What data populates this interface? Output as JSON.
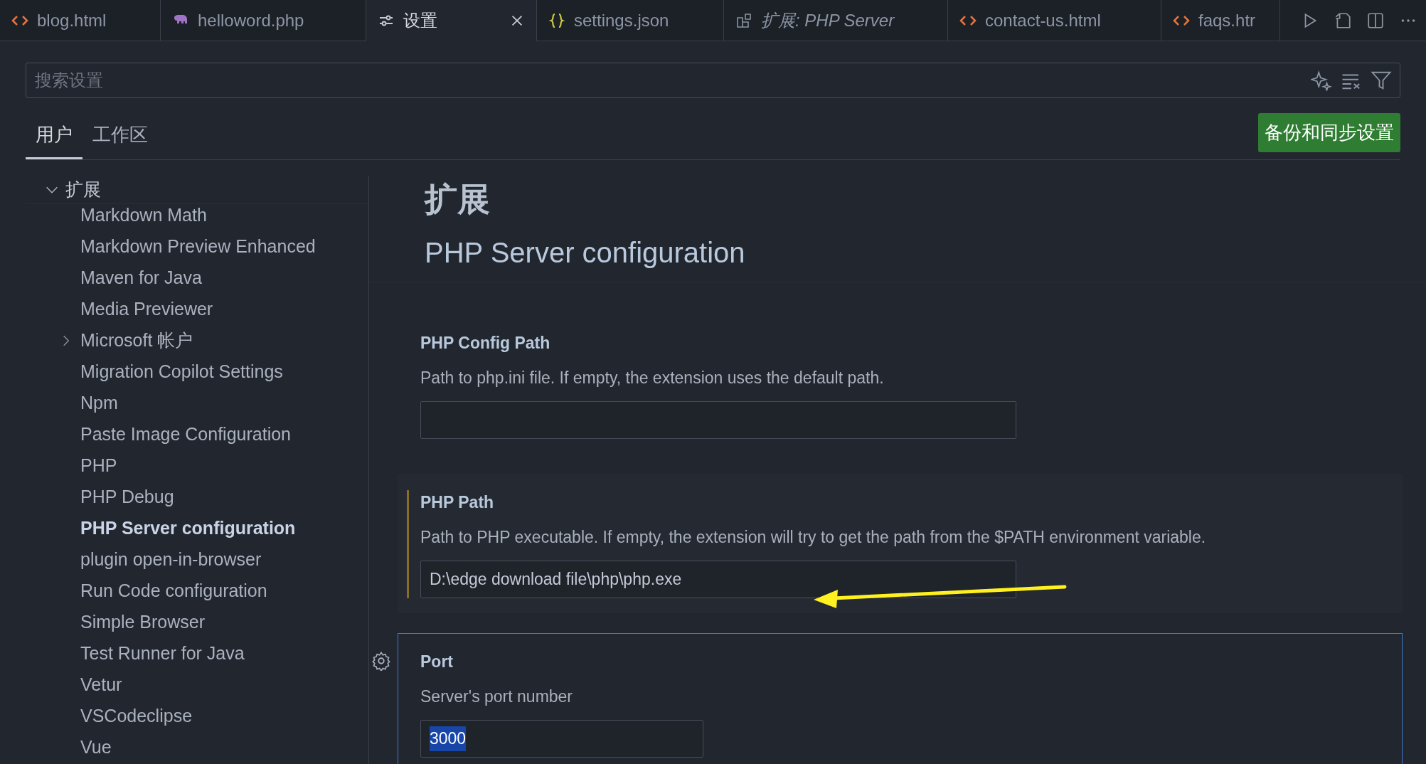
{
  "tabs": [
    {
      "label": "blog.html",
      "kind": "html",
      "selected": false
    },
    {
      "label": "helloword.php",
      "kind": "php",
      "selected": false
    },
    {
      "label": "设置",
      "kind": "settings",
      "selected": true
    },
    {
      "label": "settings.json",
      "kind": "json",
      "selected": false
    },
    {
      "label": "扩展: PHP Server",
      "kind": "extension",
      "selected": false
    },
    {
      "label": "contact-us.html",
      "kind": "html",
      "selected": false
    },
    {
      "label": "faqs.htr",
      "kind": "html",
      "selected": false
    }
  ],
  "search": {
    "placeholder": "搜索设置"
  },
  "scope_tabs": [
    {
      "label": "用户",
      "selected": true
    },
    {
      "label": "工作区",
      "selected": false
    }
  ],
  "sync_button": "备份和同步设置",
  "sidebar": {
    "group": {
      "label": "扩展",
      "expanded": true
    },
    "items": [
      {
        "label": "Markdown Math",
        "selected": false
      },
      {
        "label": "Markdown Preview Enhanced",
        "selected": false
      },
      {
        "label": "Maven for Java",
        "selected": false
      },
      {
        "label": "Media Previewer",
        "selected": false
      },
      {
        "label": "Microsoft 帐户",
        "selected": false,
        "expanded": false
      },
      {
        "label": "Migration Copilot Settings",
        "selected": false
      },
      {
        "label": "Npm",
        "selected": false
      },
      {
        "label": "Paste Image Configuration",
        "selected": false
      },
      {
        "label": "PHP",
        "selected": false
      },
      {
        "label": "PHP Debug",
        "selected": false
      },
      {
        "label": "PHP Server configuration",
        "selected": true
      },
      {
        "label": "plugin open-in-browser",
        "selected": false
      },
      {
        "label": "Run Code configuration",
        "selected": false
      },
      {
        "label": "Simple Browser",
        "selected": false
      },
      {
        "label": "Test Runner for Java",
        "selected": false
      },
      {
        "label": "Vetur",
        "selected": false
      },
      {
        "label": "VSCodeclipse",
        "selected": false
      },
      {
        "label": "Vue",
        "selected": false
      }
    ]
  },
  "content": {
    "heading": "扩展",
    "subheading": "PHP Server configuration",
    "settings": [
      {
        "title": "PHP Config Path",
        "description": "Path to php.ini file. If empty, the extension uses the default path.",
        "modified": false,
        "focused": false
      },
      {
        "title": "PHP Path",
        "description": "Path to PHP executable. If empty, the extension will try to get the path from the $PATH environment variable.",
        "value": "D:\\edge download file\\php\\php.exe",
        "modified": true,
        "focused": false
      },
      {
        "title": "Port",
        "description": "Server's port number",
        "value": "3000",
        "modified": false,
        "focused": true
      }
    ]
  }
}
